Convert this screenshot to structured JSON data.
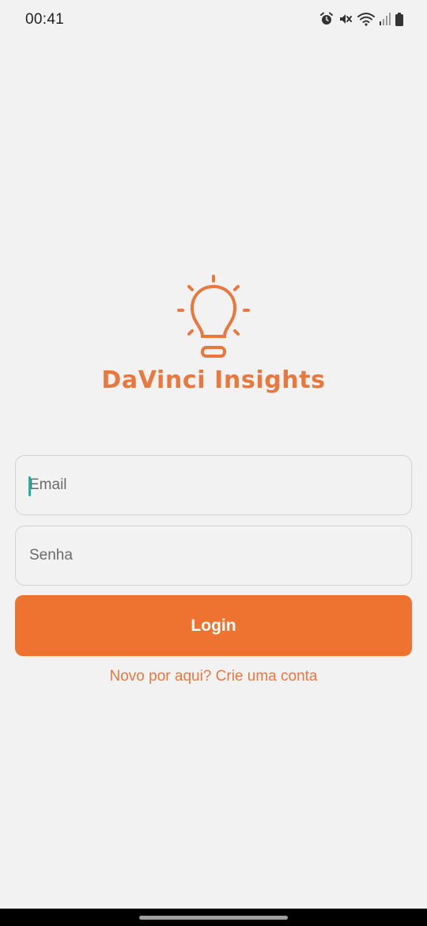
{
  "status_bar": {
    "time": "00:41",
    "icons": [
      "alarm-icon",
      "mute-icon",
      "wifi-icon",
      "signal-icon",
      "battery-icon"
    ]
  },
  "logo": {
    "icon": "lightbulb-icon",
    "title": "DaVinci Insights",
    "color": "#e9783f"
  },
  "form": {
    "email": {
      "placeholder": "Email",
      "value": ""
    },
    "password": {
      "placeholder": "Senha",
      "value": ""
    },
    "login_label": "Login",
    "login_color": "#ef7330",
    "signup_text": "Novo por aqui? Crie uma conta"
  },
  "colors": {
    "background": "#f2f2f2",
    "accent": "#ef7330",
    "caret": "#19b5a3"
  }
}
